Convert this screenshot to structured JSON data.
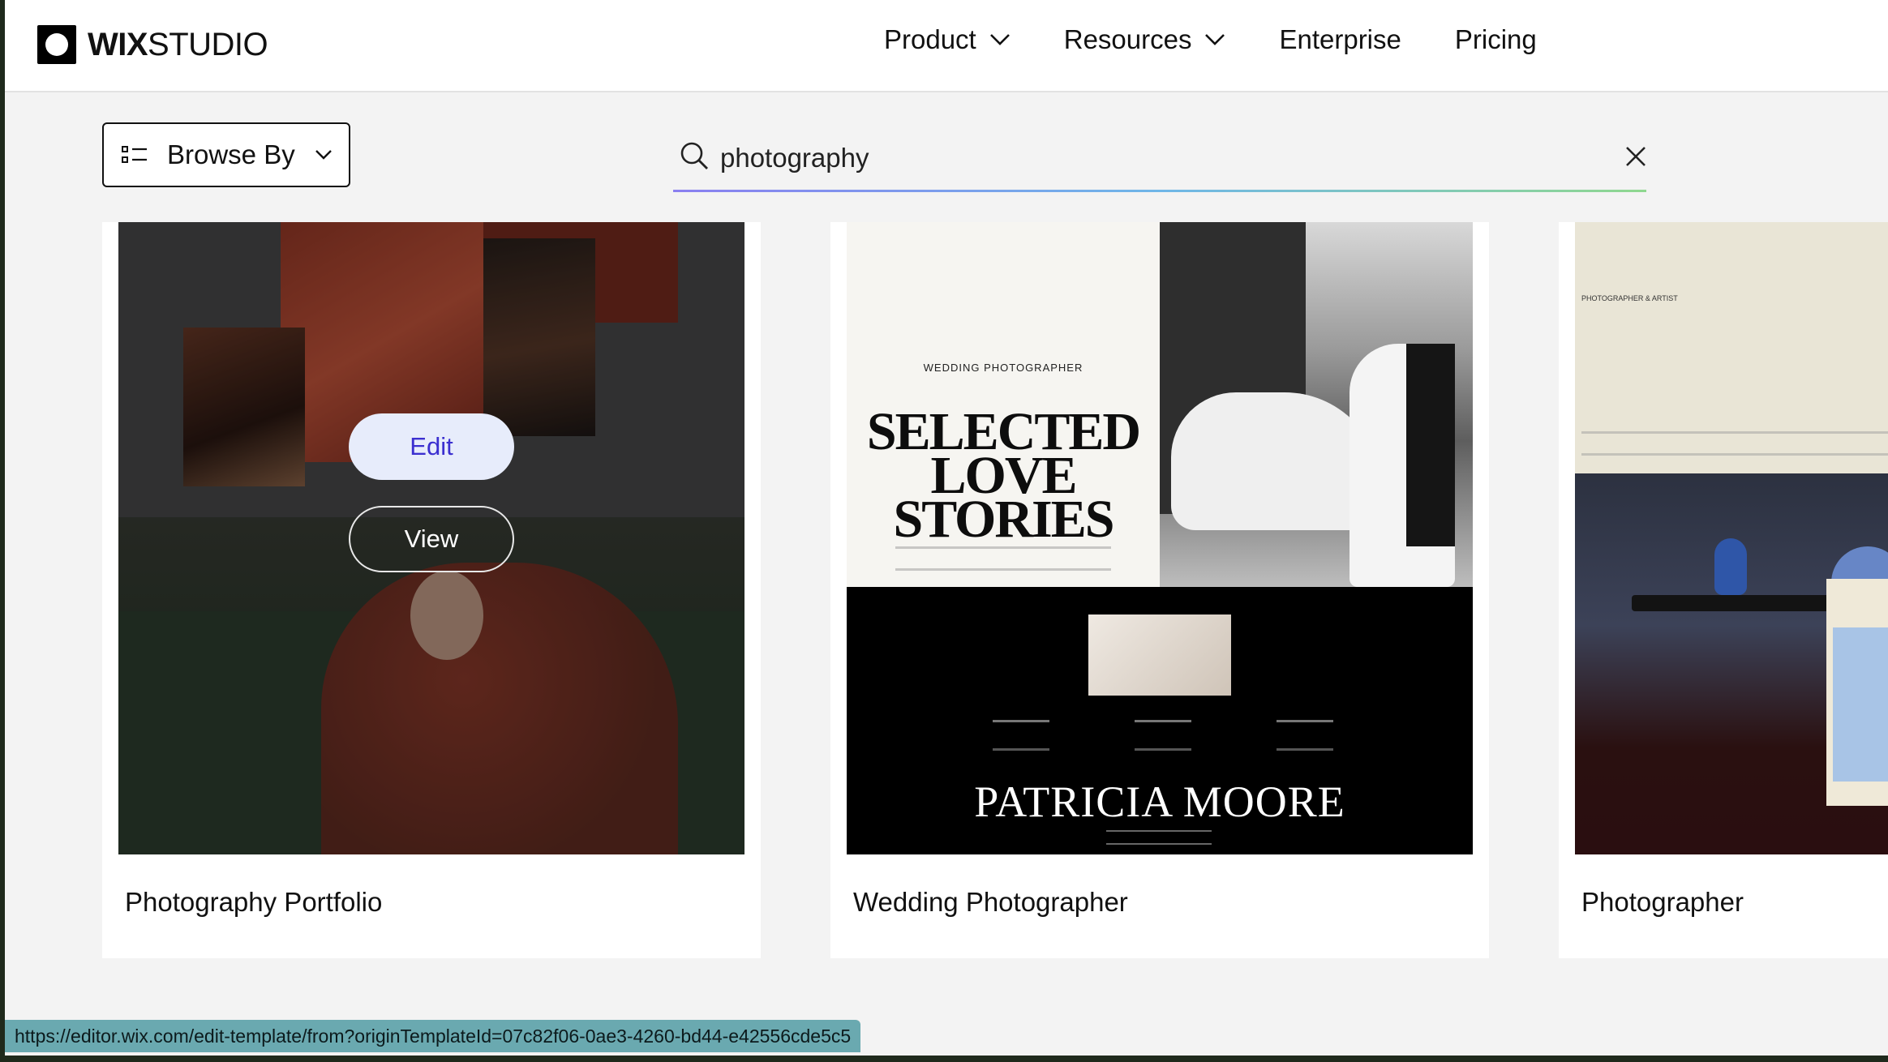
{
  "header": {
    "logo": {
      "bold": "WIX",
      "light": "STUDIO"
    },
    "nav": [
      {
        "label": "Product",
        "has_dropdown": true
      },
      {
        "label": "Resources",
        "has_dropdown": true
      },
      {
        "label": "Enterprise",
        "has_dropdown": false
      },
      {
        "label": "Pricing",
        "has_dropdown": false
      }
    ]
  },
  "toolbar": {
    "browse_label": "Browse By",
    "search_value": "photography",
    "search_placeholder": ""
  },
  "cards": [
    {
      "title": "Photography Portfolio",
      "hovered": true,
      "edit_label": "Edit",
      "view_label": "View"
    },
    {
      "title": "Wedding Photographer",
      "thumb": {
        "kicker": "WEDDING PHOTOGRAPHER",
        "headline": "SELECTED LOVE STORIES",
        "name": "PATRICIA  MOORE"
      }
    },
    {
      "title": "Photographer",
      "thumb": {
        "kicker": "PHOTOGRAPHER & ARTIST"
      }
    }
  ],
  "status_bar": {
    "url": "https://editor.wix.com/edit-template/from?originTemplateId=07c82f06-0ae3-4260-bd44-e42556cde5c5"
  },
  "colors": {
    "edit_button_bg": "#e7ecfb",
    "edit_button_text": "#3b2fd0",
    "status_bar_bg": "#6aa9b0"
  }
}
